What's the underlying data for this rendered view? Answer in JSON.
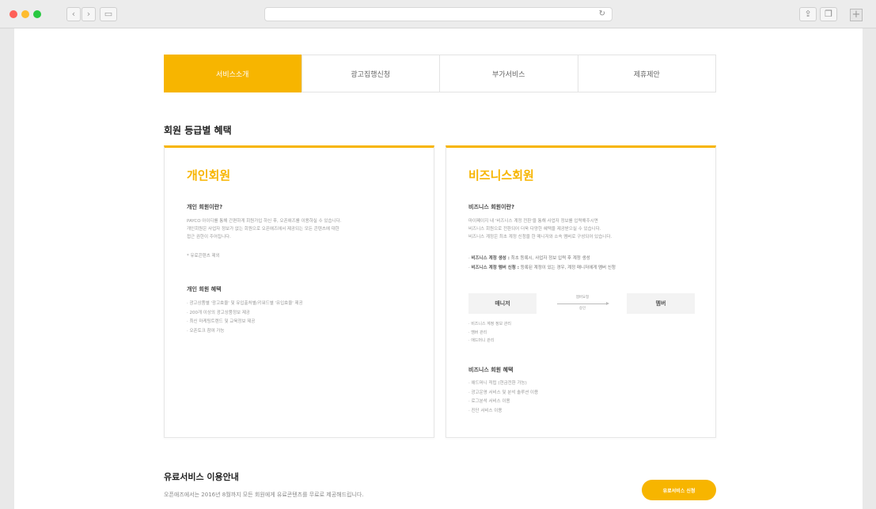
{
  "browser": {
    "back_icon": "‹",
    "forward_icon": "›",
    "sidebar_icon": "▭",
    "reload_icon": "↻",
    "share_icon": "⇪",
    "tabs_icon": "❐",
    "new_tab_icon": "+"
  },
  "tabs": [
    {
      "label": "서비스소개",
      "active": true
    },
    {
      "label": "광고집행신청",
      "active": false
    },
    {
      "label": "부가서비스",
      "active": false
    },
    {
      "label": "제휴제안",
      "active": false
    }
  ],
  "section_title": "회원 등급별 혜택",
  "personal": {
    "title": "개인회원",
    "what_heading": "개인 회원이란?",
    "what_desc": [
      "PAYCO 아이디를 통해 간편하게 회원가입 하신 후, 오픈애즈를 이용하실 수 있습니다.",
      "개인회원은 사업자 정보가 없는 회원으로 오픈애즈에서 제공되는 모든 콘텐츠에 대한",
      "접근 권한이 주어집니다."
    ],
    "note": "* 유료콘텐츠 제외",
    "benefit_heading": "개인 회원 혜택",
    "benefits": [
      "광고상품별 '광고효율' 및 유입출처별/키워드별 '유입효율' 제공",
      "200개 이상의 광고상품정보 제공",
      "최신 마케팅트렌드 및 교육정보 제공",
      "오픈토크 참여 가능"
    ]
  },
  "business": {
    "title": "비즈니스회원",
    "what_heading": "비즈니스 회원이란?",
    "what_desc": [
      "마이페이지 내 '비즈니스 계정 전환'을 통해 사업자 정보를 입력해주시면",
      "비즈니스 회원으로 전환되어 더욱 다양한 혜택을 제공받으실 수 있습니다.",
      "비즈니스 계정은 최초 계정 신청을 한 매니저와 소속 멤버로 구성되어 있습니다."
    ],
    "highlights": [
      {
        "bold": "비즈니스 계정 생성 :",
        "text": " 최초 등록시, 사업자 정보 입력 후 계정 생성"
      },
      {
        "bold": "비즈니스 계정 멤버 신청 :",
        "text": " 등록된 계정이 있는 경우, 계정 매니저에게 멤버 신청"
      }
    ],
    "manager_label": "매니저",
    "member_label": "멤버",
    "arrow_top": "멤버요청",
    "arrow_bottom": "승인",
    "manager_duties": [
      "비즈니스 계정 정보 관리",
      "멤버 관리",
      "애드머니 관리"
    ],
    "benefit_heading": "비즈니스 회원 혜택",
    "benefits": [
      "애드머니 적립 (현금전환 가능)",
      "광고운영 서비스 및 분석 솔루션 이용",
      "로그분석 서비스 이용",
      "진단 서비스 이용"
    ]
  },
  "paid": {
    "title": "유료서비스 이용안내",
    "desc": "오픈애즈에서는 2016년 8월까지 모든 회원에게 유료콘텐츠를 무료로 제공해드립니다.",
    "button": "유료서비스 신청"
  },
  "colors": {
    "accent": "#f7b500"
  }
}
